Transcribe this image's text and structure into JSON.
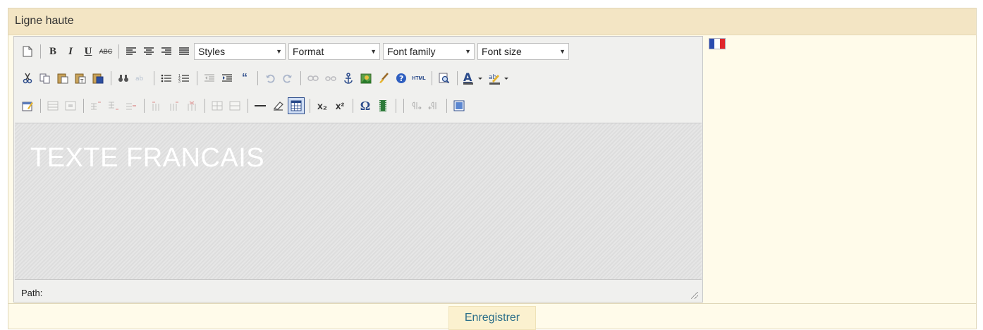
{
  "section": {
    "title": "Ligne haute"
  },
  "toolbar": {
    "styles": "Styles",
    "format": "Format",
    "font_family": "Font family",
    "font_size": "Font size",
    "bold": "B",
    "italic": "I",
    "underline": "U",
    "strike": "ABC",
    "html": "HTML",
    "subscript": "x₂",
    "superscript": "x²",
    "omega": "Ω"
  },
  "editor": {
    "content_text": "TEXTE FRANCAIS",
    "path_label": "Path:"
  },
  "language": {
    "icon": "french-flag-icon",
    "colors": [
      "#2a4bb0",
      "#ffffff",
      "#e0262b"
    ]
  },
  "footer": {
    "save_label": "Enregistrer"
  }
}
